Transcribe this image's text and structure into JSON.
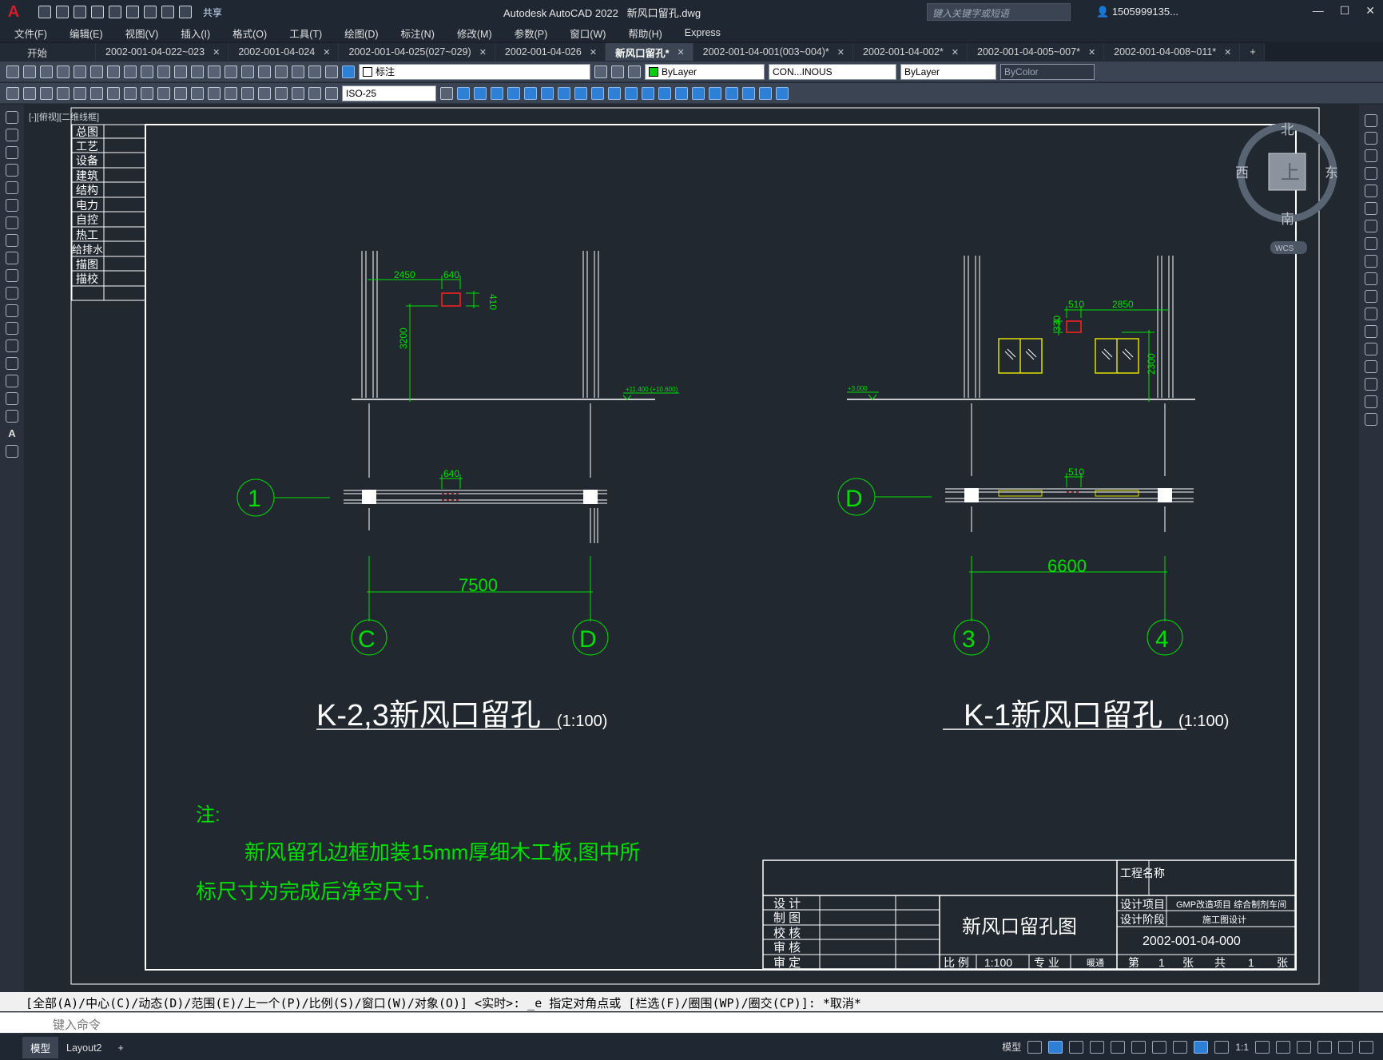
{
  "titlebar": {
    "app_title": "Autodesk AutoCAD 2022",
    "file_name": "新风口留孔.dwg",
    "share_label": "共享",
    "search_placeholder": "键入关键字或短语",
    "user_name": "1505999135..."
  },
  "menu": [
    "文件(F)",
    "编辑(E)",
    "视图(V)",
    "插入(I)",
    "格式(O)",
    "工具(T)",
    "绘图(D)",
    "标注(N)",
    "修改(M)",
    "参数(P)",
    "窗口(W)",
    "帮助(H)",
    "Express"
  ],
  "tabs": [
    {
      "label": "开始",
      "close": false
    },
    {
      "label": "2002-001-04-022~023",
      "close": true
    },
    {
      "label": "2002-001-04-024",
      "close": true
    },
    {
      "label": "2002-001-04-025(027~029)",
      "close": true
    },
    {
      "label": "2002-001-04-026",
      "close": true
    },
    {
      "label": "新风口留孔*",
      "close": true,
      "active": true
    },
    {
      "label": "2002-001-04-001(003~004)*",
      "close": true
    },
    {
      "label": "2002-001-04-002*",
      "close": true
    },
    {
      "label": "2002-001-04-005~007*",
      "close": true
    },
    {
      "label": "2002-001-04-008~011*",
      "close": true
    }
  ],
  "toolbar": {
    "layer_value": "标注",
    "color_value": "ByLayer",
    "linetype_value": "CON...INOUS",
    "lineweight_value": "ByLayer",
    "plotstyle_value": "ByColor",
    "dimstyle_value": "ISO-25"
  },
  "viewport": {
    "label": "[-][俯视][二维线框]",
    "viewcube": {
      "north": "北",
      "south": "南",
      "east": "东",
      "west": "西",
      "top": "上",
      "wcs": "WCS"
    }
  },
  "drawing": {
    "disciplines": [
      "总图",
      "工艺",
      "设备",
      "建筑",
      "结构",
      "电力",
      "自控",
      "热工",
      "给排水",
      "描图",
      "描校"
    ],
    "left_view": {
      "dim_2450": "2450",
      "dim_640": "640",
      "dim_410": "410",
      "dim_3200": "3200",
      "elev": "+11.400 (+10.600)",
      "dim_plan_640": "640",
      "dim_7500": "7500",
      "axis_1": "1",
      "axis_c": "C",
      "axis_d": "D",
      "title": "K-2,3新风口留孔",
      "scale": "(1:100)"
    },
    "right_view": {
      "dim_510": "510",
      "dim_2850": "2850",
      "dim_330": "330",
      "dim_2300": "2300",
      "elev": "+3.000",
      "dim_plan_510": "510",
      "dim_6600": "6600",
      "axis_d": "D",
      "axis_3": "3",
      "axis_4": "4",
      "title": "K-1新风口留孔",
      "scale": "(1:100)"
    },
    "notes": {
      "heading": "注:",
      "line1": "新风留孔边框加装15mm厚细木工板,图中所",
      "line2": "标尺寸为完成后净空尺寸."
    },
    "title_block": {
      "roles": [
        "设 计",
        "制 图",
        "校 核",
        "审 核",
        "审 定"
      ],
      "drawing_title": "新风口留孔图",
      "project_name_label": "工程名称",
      "design_project_label": "设计项目",
      "design_project_value": "GMP改造项目 综合制剂车间",
      "design_stage_label": "设计阶段",
      "design_stage_value": "施工图设计",
      "drawing_no": "2002-001-04-000",
      "scale_label": "比 例",
      "scale_value": "1:100",
      "discipline_label": "专 业",
      "discipline_value": "暖通",
      "sheet_label": "第",
      "sheet_no": "1",
      "sheet_unit": "张",
      "total_label": "共",
      "total_no": "1",
      "total_unit": "张"
    }
  },
  "command": {
    "history": "[全部(A)/中心(C)/动态(D)/范围(E)/上一个(P)/比例(S)/窗口(W)/对象(O)] <实时>: _e 指定对角点或 [栏选(F)/圈围(WP)/圈交(CP)]: *取消*",
    "placeholder": "键入命令"
  },
  "status": {
    "layout_tabs": [
      "模型",
      "Layout2"
    ],
    "model_label": "模型",
    "scale": "1:1"
  }
}
